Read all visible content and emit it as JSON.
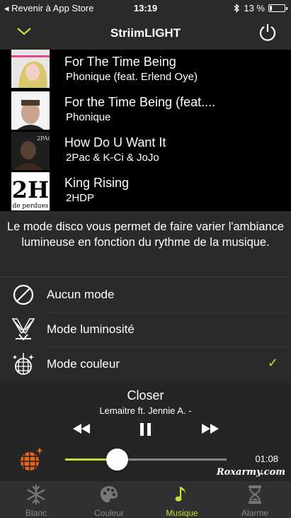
{
  "status_bar": {
    "back_label": "◂ Revenir à App Store",
    "time": "13:19",
    "battery_text": "13 %",
    "battery_level": 0.13
  },
  "nav": {
    "title": "StriimLIGHT",
    "chevron_icon": "chevron-down-icon",
    "power_icon": "power-icon"
  },
  "tracks": [
    {
      "title": "For The Time Being",
      "artist": "Phonique  (feat. Erlend Oye)"
    },
    {
      "title": "For the Time Being (feat....",
      "artist": "Phonique"
    },
    {
      "title": "How Do U Want It",
      "artist": "2Pac & K-Ci & JoJo"
    },
    {
      "title": "King Rising",
      "artist": "2HDP"
    }
  ],
  "album_art_text": {
    "track3_corner": "2PAC",
    "track4_big": "2H",
    "track4_small": "de perdues"
  },
  "description": "Le mode disco vous permet de faire varier l'ambiance lumineuse en fonction du rythme de la musique.",
  "modes": [
    {
      "label": "Aucun mode",
      "icon": "no-mode-icon",
      "selected": false
    },
    {
      "label": "Mode luminosité",
      "icon": "light-beams-icon",
      "selected": false
    },
    {
      "label": "Mode couleur",
      "icon": "disco-ball-icon",
      "selected": true,
      "check": "✓"
    }
  ],
  "player": {
    "song": "Closer",
    "artist": "Lemaitre ft. Jennie A. -",
    "elapsed": "01:08",
    "progress": 0.32,
    "prev_icon": "rewind-icon",
    "pause_icon": "pause-icon",
    "next_icon": "fast-forward-icon"
  },
  "watermark": "Roxarmy.com",
  "tabs": [
    {
      "label": "Blanc",
      "icon": "snowflake-icon",
      "active": false
    },
    {
      "label": "Couleur",
      "icon": "palette-icon",
      "active": false
    },
    {
      "label": "Musique",
      "icon": "music-note-icon",
      "active": true
    },
    {
      "label": "Alarme",
      "icon": "hourglass-icon",
      "active": false
    }
  ],
  "colors": {
    "accent": "#c8dc3c",
    "background": "#2a2a2a",
    "list_background": "#000000",
    "tab_inactive": "#8a8a8a"
  }
}
